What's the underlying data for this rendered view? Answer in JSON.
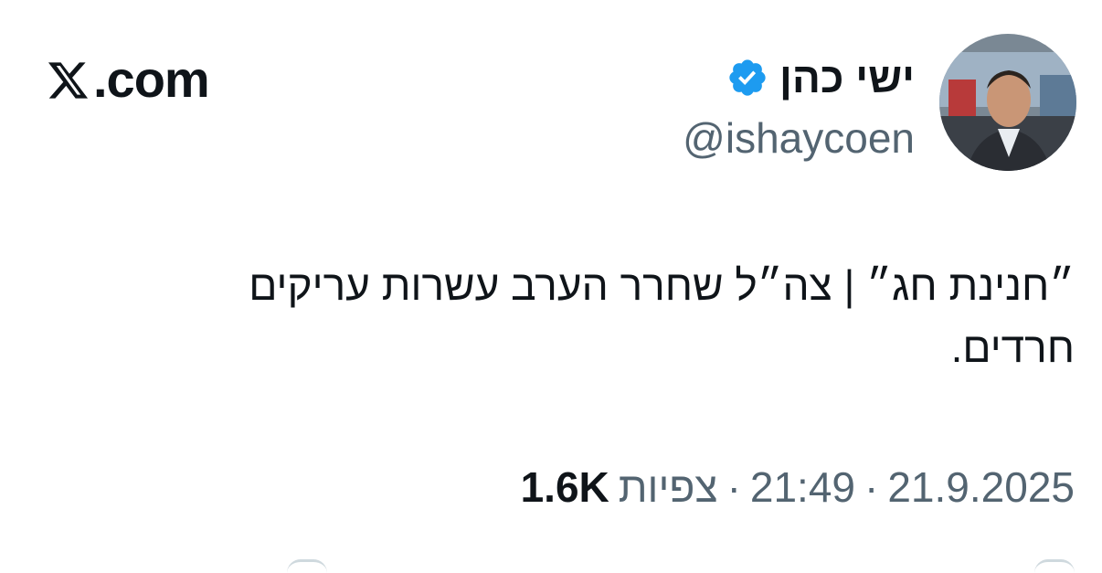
{
  "brand": {
    "text": ".com",
    "logo_icon": "x-logo-icon"
  },
  "author": {
    "display_name": "ישי כהן",
    "handle": "@ishaycoen",
    "verified_icon": "verified-badge-icon",
    "verified_color": "#1d9bf0"
  },
  "tweet": {
    "text": "״חנינת חג״ | צה״ל שחרר הערב עשרות עריקים\nחרדים."
  },
  "meta": {
    "date": "21.9.2025",
    "separator": "·",
    "time": "21:49",
    "views_label": "צפיות",
    "views_count": "1.6K"
  },
  "colors": {
    "text_primary": "#0f1419",
    "text_secondary": "#536471",
    "accent": "#1d9bf0"
  }
}
